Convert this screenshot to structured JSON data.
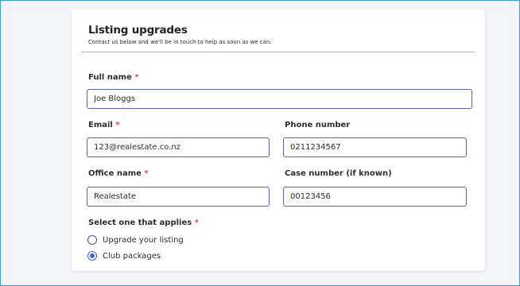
{
  "form": {
    "title": "Listing upgrades",
    "subtitle": "Contact us below and we'll be in touch to help as soon as we can.",
    "required_marker": "*",
    "full_name": {
      "label": "Full name",
      "value": "Joe Bloggs"
    },
    "email": {
      "label": "Email",
      "value": "123@realestate.co.nz"
    },
    "phone": {
      "label": "Phone number",
      "value": "0211234567"
    },
    "office": {
      "label": "Office name",
      "value": "Realestate"
    },
    "case_number": {
      "label": "Case number (if known)",
      "value": "00123456"
    },
    "applies": {
      "label": "Select one that applies",
      "options": [
        {
          "label": "Upgrade your listing",
          "selected": false
        },
        {
          "label": "Club packages",
          "selected": true
        }
      ]
    }
  },
  "colors": {
    "accent": "#3a63e0",
    "input_border": "#5961b8",
    "required": "#e0483e",
    "frame_border": "#3b9bd6"
  }
}
